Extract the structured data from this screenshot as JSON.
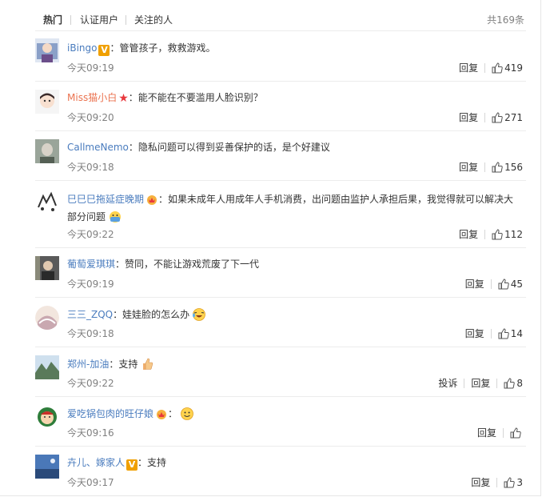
{
  "tabs": {
    "hot": "热门",
    "verified": "认证用户",
    "following": "关注的人"
  },
  "total": "共169条",
  "labels": {
    "reply": "回复",
    "report": "投诉"
  },
  "comments": [
    {
      "user": "iBingo",
      "sep": "：",
      "text": "管管孩子，救救游戏。",
      "time": "今天09:19",
      "likes": "419"
    },
    {
      "user": "Miss猫小白",
      "sep": "：",
      "text": "能不能在不要滥用人脸识别？",
      "time": "今天09:20",
      "likes": "271"
    },
    {
      "user": "CallmeNemo",
      "sep": "：",
      "text": "隐私问题可以得到妥善保护的话，是个好建议",
      "time": "今天09:18",
      "likes": "156"
    },
    {
      "user": "巳巳巳拖延症晚期",
      "sep": "：",
      "text": "如果未成年人用成年人手机消费，出问题由监护人承担后果，我觉得就可以解决大部分问题",
      "time": "今天09:22",
      "likes": "112"
    },
    {
      "user": "葡萄爱琪琪",
      "sep": "：",
      "text": "赞同，不能让游戏荒废了下一代",
      "time": "今天09:19",
      "likes": "45"
    },
    {
      "user": "三三_ZQQ",
      "sep": "：",
      "text": "娃娃脸的怎么办",
      "time": "今天09:18",
      "likes": "14"
    },
    {
      "user": "郑州-加油",
      "sep": "：",
      "text": "支持",
      "time": "今天09:22",
      "likes": "8"
    },
    {
      "user": "爱吃锅包肉的旺仔娘",
      "sep": "：",
      "text": "",
      "time": "今天09:16",
      "likes": ""
    },
    {
      "user": "卉儿、嫁家人",
      "sep": "：",
      "text": "支持",
      "time": "今天09:17",
      "likes": "3"
    }
  ],
  "colors": {
    "username": "#eb7350",
    "time": "#808080",
    "divider": "#ececec",
    "vbadge": "#f0a000"
  }
}
